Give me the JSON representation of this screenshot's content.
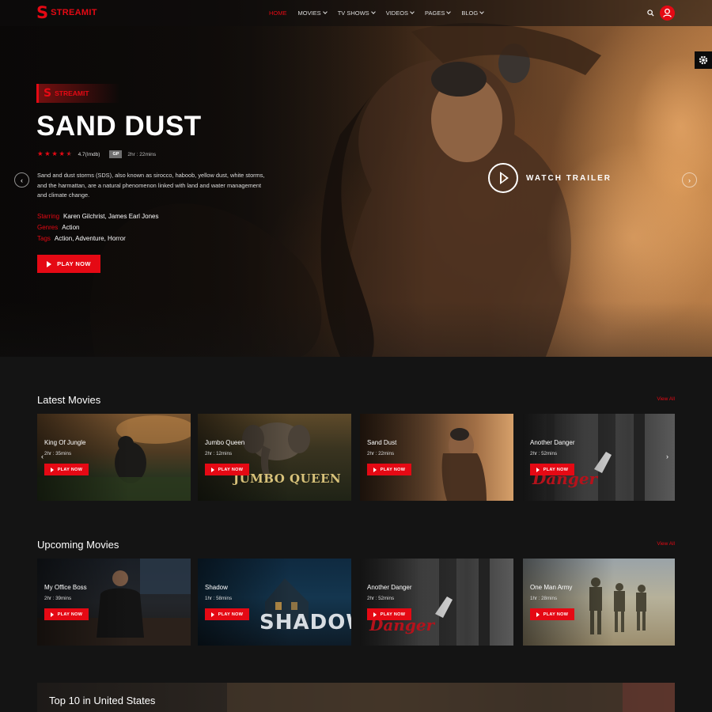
{
  "brand": {
    "logo_letter": "S",
    "name": "STREAMIT",
    "accent_color": "#e50914"
  },
  "nav": {
    "items": [
      {
        "label": "HOME",
        "active": true,
        "dropdown": false
      },
      {
        "label": "MOVIES",
        "active": false,
        "dropdown": true
      },
      {
        "label": "TV SHOWS",
        "active": false,
        "dropdown": true
      },
      {
        "label": "VIDEOS",
        "active": false,
        "dropdown": true
      },
      {
        "label": "PAGES",
        "active": false,
        "dropdown": true
      },
      {
        "label": "BLOG",
        "active": false,
        "dropdown": true
      }
    ],
    "icons": [
      "search-icon",
      "user-icon"
    ]
  },
  "settings_icon": "gear-icon",
  "hero": {
    "badge_letter": "S",
    "badge_text": "STREAMIT",
    "title": "SAND DUST",
    "stars": 4.5,
    "rating": "4.7(Imdb)",
    "age_badge": "GP",
    "duration": "2hr : 22mins",
    "description": "Sand and dust storms (SDS), also known as sirocco, haboob, yellow dust, white storms, and the harmattan, are a natural phenomenon linked with land and water management and climate change.",
    "meta": [
      {
        "key": "Starring",
        "value": "Karen Gilchrist, James Earl Jones"
      },
      {
        "key": "Genres",
        "value": "Action"
      },
      {
        "key": "Tags",
        "value": "Action, Adventure, Horror"
      }
    ],
    "play_label": "PLAY NOW",
    "trailer_label": "WATCH TRAILER"
  },
  "latest": {
    "title": "Latest Movies",
    "view_all": "View All",
    "movies": [
      {
        "title": "King Of Jungle",
        "duration": "2hr : 35mins",
        "button": "PLAY NOW"
      },
      {
        "title": "Jumbo Queen",
        "duration": "2hr : 12mins",
        "button": "PLAY NOW",
        "art_text": "JUMBO QUEEN"
      },
      {
        "title": "Sand Dust",
        "duration": "2hr : 22mins",
        "button": "PLAY NOW"
      },
      {
        "title": "Another Danger",
        "duration": "2hr : 52mins",
        "button": "PLAY NOW",
        "art_text": "Danger"
      }
    ]
  },
  "upcoming": {
    "title": "Upcoming Movies",
    "view_all": "View All",
    "movies": [
      {
        "title": "My Office Boss",
        "duration": "2hr : 39mins",
        "button": "PLAY NOW"
      },
      {
        "title": "Shadow",
        "duration": "1hr : 58mins",
        "button": "PLAY NOW",
        "art_text": "SHADOW"
      },
      {
        "title": "Another Danger",
        "duration": "2hr : 52mins",
        "button": "PLAY NOW",
        "art_text": "Danger"
      },
      {
        "title": "One Man Army",
        "duration": "1hr : 28mins",
        "button": "PLAY NOW"
      }
    ]
  },
  "top10": {
    "title": "Top 10 in United States"
  }
}
